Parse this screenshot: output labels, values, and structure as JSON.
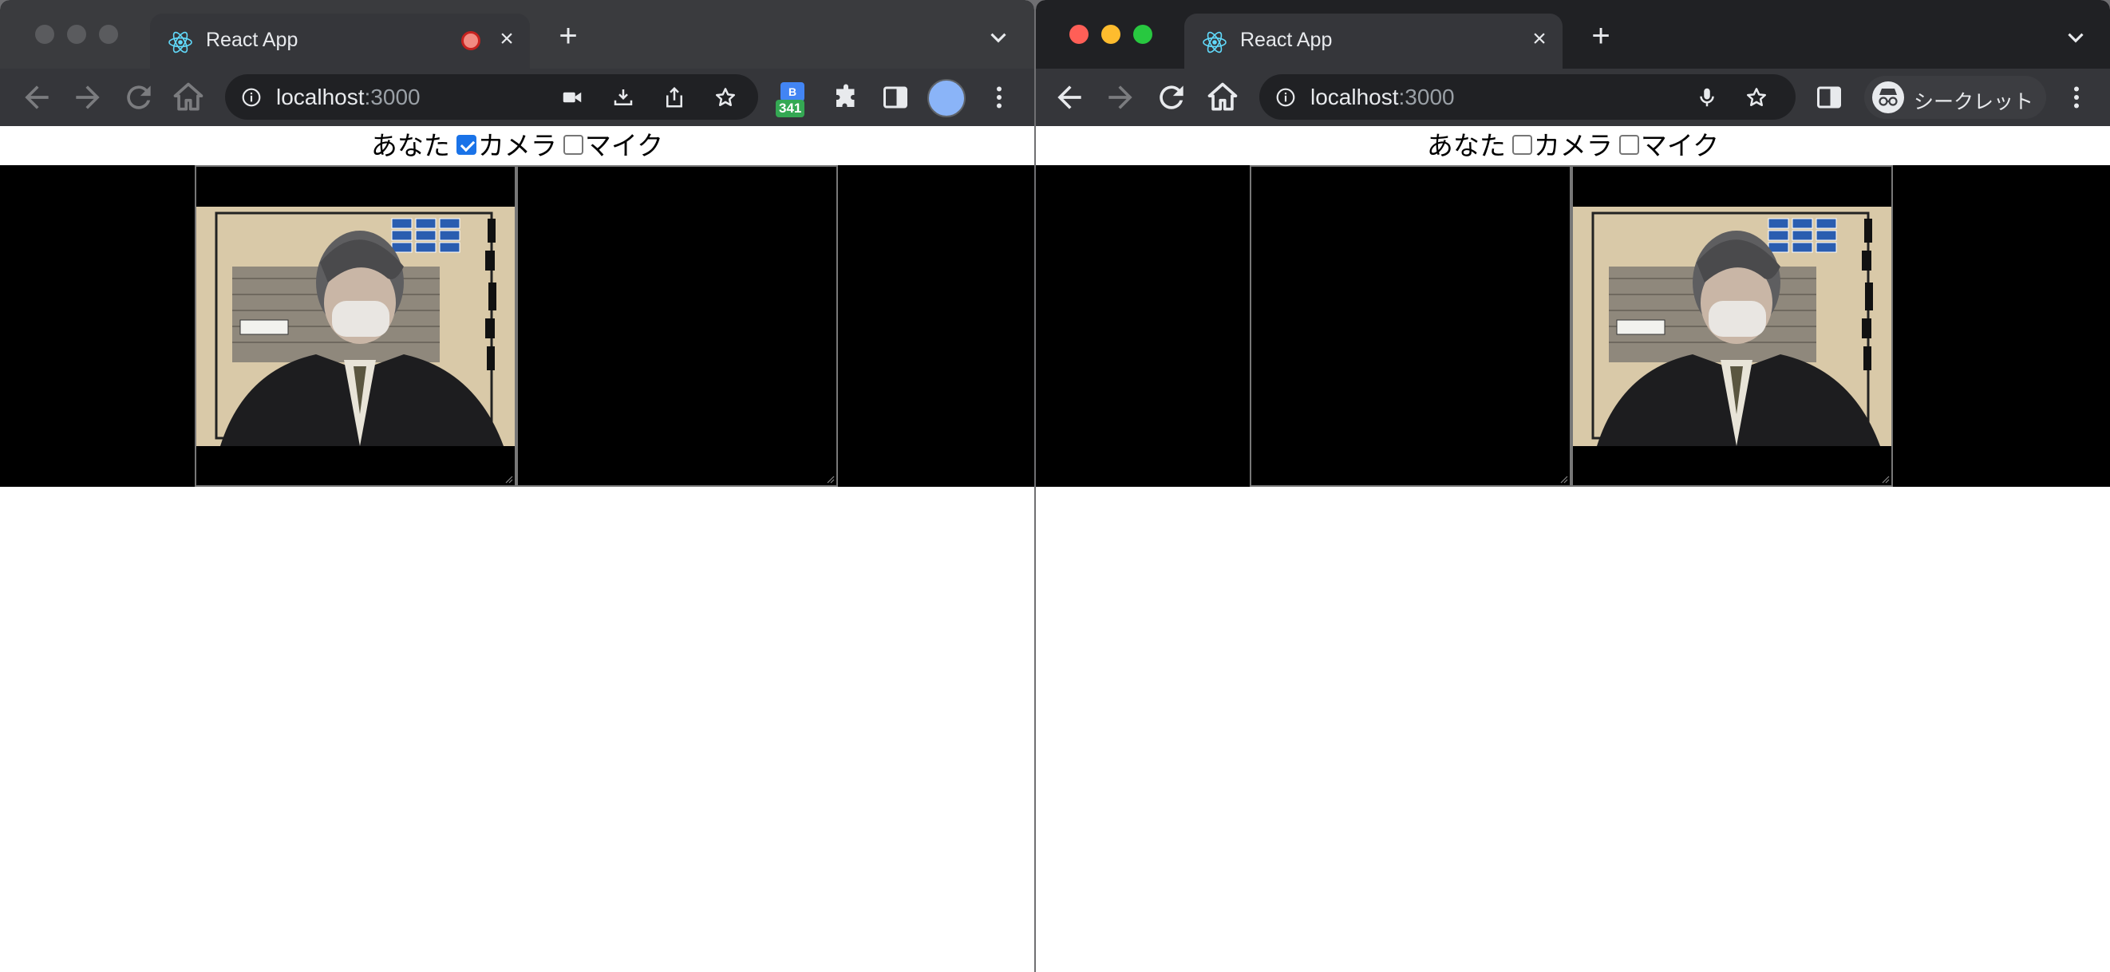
{
  "windows": [
    {
      "tab": {
        "title": "React App",
        "recording": true
      },
      "address": {
        "host": "localhost",
        "port": ":3000"
      },
      "page": {
        "user_label": "あなた",
        "camera": {
          "label": "カメラ",
          "checked": true
        },
        "mic": {
          "label": "マイク",
          "checked": false
        }
      },
      "extension_badge": "341"
    },
    {
      "tab": {
        "title": "React App",
        "recording": false
      },
      "address": {
        "host": "localhost",
        "port": ":3000"
      },
      "incognito_label": "シークレット",
      "page": {
        "user_label": "あなた",
        "camera": {
          "label": "カメラ",
          "checked": false
        },
        "mic": {
          "label": "マイク",
          "checked": false
        }
      }
    }
  ],
  "colors": {
    "tab_bg": "#35363a",
    "strip_bg": "#202124",
    "checkbox_checked": "#1a73e8"
  }
}
